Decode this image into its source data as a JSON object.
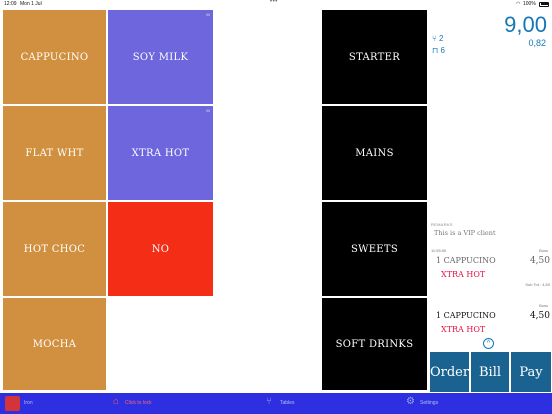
{
  "status": {
    "time": "12:09",
    "date": "Mon 1 Jul",
    "battery": "100%"
  },
  "tiles": {
    "cappucino": "CAPPUCINO",
    "soy_milk": "SOY MILK",
    "flat_wht": "FLAT WHT",
    "xtra_hot": "XTRA HOT",
    "hot_choc": "HOT CHOC",
    "no": "NO",
    "mocha": "MOCHA"
  },
  "categories": {
    "starter": "STARTER",
    "mains": "MAINS",
    "sweets": "SWEETS",
    "soft_drinks": "SOFT DRINKS"
  },
  "order": {
    "total": "9,00",
    "subtotal": "0,82",
    "covers": "2",
    "seats": "6",
    "remarks_label": "REMARKS",
    "remarks": "This is a VIP client",
    "items": [
      {
        "time": "11:55:50",
        "tag": "Boss",
        "name": "1 CAPPUCINO",
        "price": "4,50",
        "modifier": "XTRA HOT"
      },
      {
        "tag": "Boss",
        "name": "1 CAPPUCINO",
        "price": "4,50",
        "modifier": "XTRA HOT"
      }
    ],
    "subtot_label": "Sub Tot.: 4,50"
  },
  "actions": {
    "order": "Order",
    "bill": "Bill",
    "pay": "Pay"
  },
  "tabbar": {
    "user": "Iron",
    "lock": "Click to lock",
    "tables": "Tables",
    "settings": "Settings"
  },
  "colors": {
    "accent": "#1577b6",
    "tabbar": "#2d2fe0",
    "modifier": "#e8103f"
  }
}
